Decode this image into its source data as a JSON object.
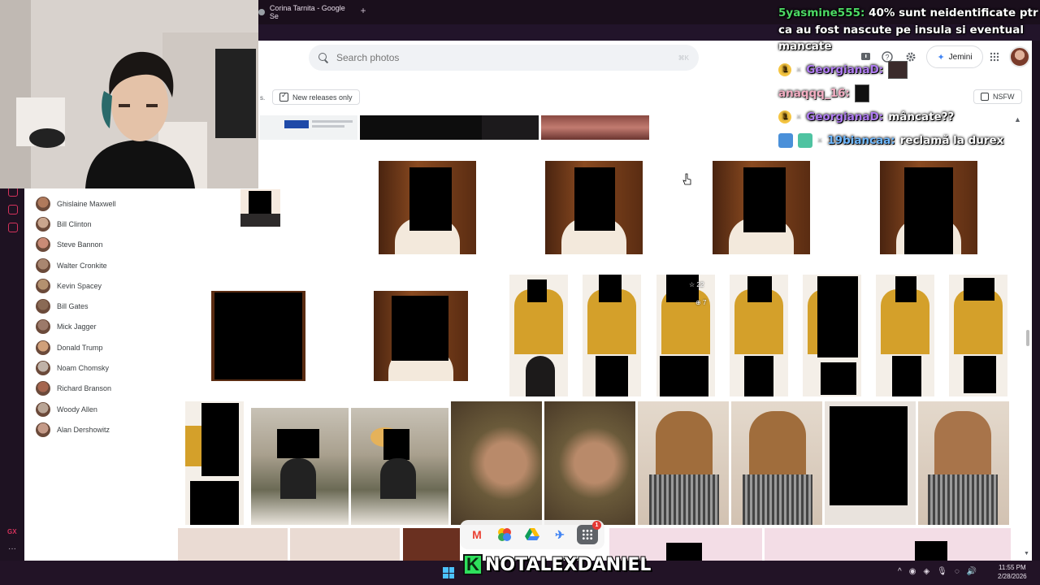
{
  "browser": {
    "tab_title": "Corina Tarnita - Google Se",
    "new_tab_glyph": "+",
    "left_strip_label": "GX",
    "left_strip_more": "···"
  },
  "header": {
    "search_placeholder": "Search photos",
    "search_shortcut": "⌘K",
    "jemini_label": "Jemini",
    "icons": [
      "feedback-icon",
      "help-icon",
      "settings-icon",
      "apps-grid-icon"
    ]
  },
  "filters": {
    "s_label": "s.",
    "new_releases_label": "New releases only",
    "new_releases_checked": true,
    "nsfw_label": "NSFW",
    "nsfw_checked": false
  },
  "people": [
    {
      "name": "Ghislaine Maxwell",
      "color": "#b07a5c"
    },
    {
      "name": "Bill Clinton",
      "color": "#c9a58d"
    },
    {
      "name": "Steve Bannon",
      "color": "#c98b76"
    },
    {
      "name": "Walter Cronkite",
      "color": "#a98670"
    },
    {
      "name": "Kevin Spacey",
      "color": "#b4916f"
    },
    {
      "name": "Bill Gates",
      "color": "#8a6a55"
    },
    {
      "name": "Mick Jagger",
      "color": "#9c7a6a"
    },
    {
      "name": "Donald Trump",
      "color": "#d0a07a"
    },
    {
      "name": "Noam Chomsky",
      "color": "#bfb2a8"
    },
    {
      "name": "Richard Branson",
      "color": "#a5654e"
    },
    {
      "name": "Woody Allen",
      "color": "#b9a596"
    },
    {
      "name": "Alan Dershowitz",
      "color": "#c49a88"
    }
  ],
  "photo_overlay": {
    "star_count": "22",
    "zoom_count": "7"
  },
  "chat": [
    {
      "user": "5yasmine555:",
      "message": "40% sunt neidentificate ptr ca au fost nascute pe insula si eventual mancate"
    },
    {
      "user": "GeorgianaD:",
      "message": "",
      "badge": "1"
    },
    {
      "user": "anaqqq_16:",
      "message": ""
    },
    {
      "user": "GeorgianaD:",
      "message": "mâncate??",
      "badge": "1"
    },
    {
      "user": "19biancaa:",
      "message": "reclamă la durex"
    }
  ],
  "dock": {
    "notification_count": "1",
    "apps": [
      "gmail-icon",
      "photos-icon",
      "drive-icon",
      "flights-icon",
      "apps-icon"
    ]
  },
  "taskbar": {
    "brand_letter": "K",
    "brand_text": "NOTALEXDANIEL",
    "time": "11:55 PM",
    "date": "2/28/2026"
  },
  "colors": {
    "accent_green": "#2ee05c",
    "chat_user_green": "#4cd964",
    "chat_user_purple": "#b07cf2",
    "taskbar": "#221326"
  }
}
